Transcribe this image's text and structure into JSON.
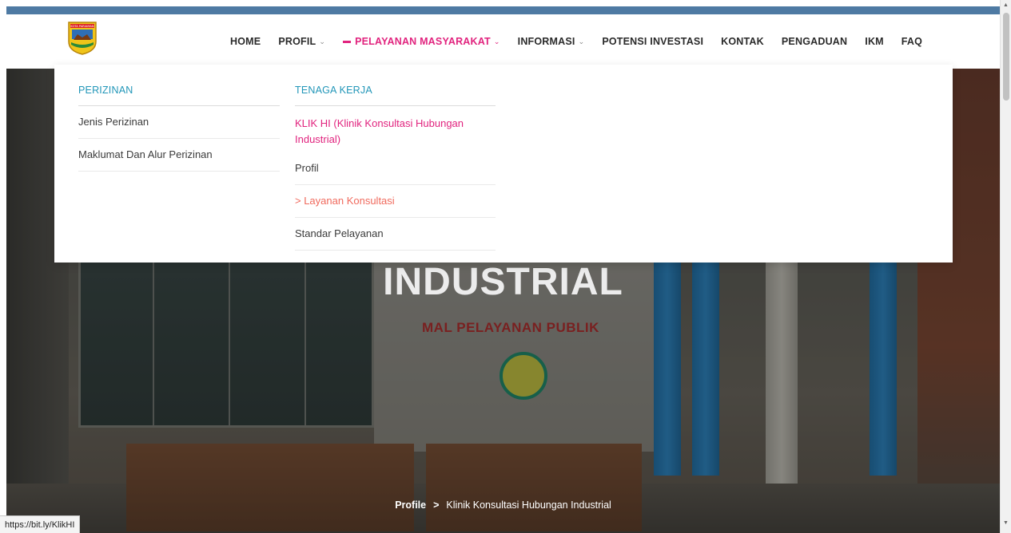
{
  "nav": {
    "home": "HOME",
    "profil": "PROFIL",
    "pelayanan": "PELAYANAN MASYARAKAT",
    "informasi": "INFORMASI",
    "potensi": "POTENSI INVESTASI",
    "kontak": "KONTAK",
    "pengaduan": "PENGADUAN",
    "ikm": "IKM",
    "faq": "FAQ"
  },
  "logo": {
    "top_text": "KOTA PARIAMAN"
  },
  "mega_menu": {
    "col1": {
      "heading": "PERIZINAN",
      "items": [
        "Jenis Perizinan",
        "Maklumat Dan Alur Perizinan"
      ]
    },
    "col2": {
      "heading": "TENAGA KERJA",
      "sub_heading": "KLIK HI (Klinik Konsultasi Hubungan Industrial)",
      "items": [
        "Profil",
        "> Layanan Konsultasi",
        "Standar Pelayanan"
      ]
    }
  },
  "hero": {
    "title": "INDUSTRIAL",
    "sign": "MAL  PELAYANAN PUBLIK",
    "breadcrumb": {
      "link": "Profile",
      "separator": ">",
      "current": "Klinik Konsultasi Hubungan Industrial"
    }
  },
  "status_bar": {
    "url": "https://bit.ly/KlikHI"
  },
  "colors": {
    "accent_pink": "#e1237e",
    "accent_blue": "#2196b8",
    "top_bar": "#4e7aa3",
    "current_item": "#f06a5d"
  }
}
